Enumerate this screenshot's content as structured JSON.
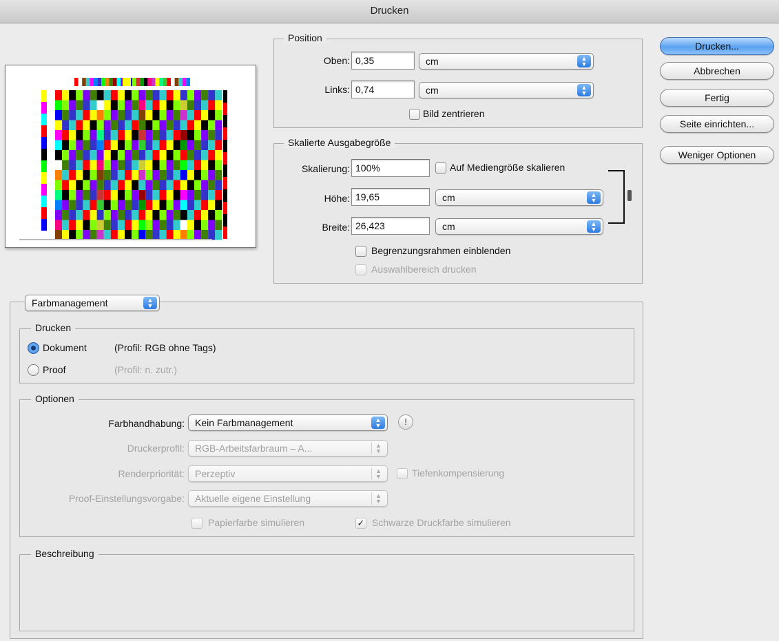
{
  "window": {
    "title": "Drucken"
  },
  "preview": {
    "caption": "Image of test colour chart"
  },
  "position": {
    "legend": "Position",
    "top_label": "Oben:",
    "top_value": "0,35",
    "top_unit": "cm",
    "left_label": "Links:",
    "left_value": "0,74",
    "left_unit": "cm",
    "center_label": "Bild zentrieren",
    "center_checked": false
  },
  "scaled": {
    "legend": "Skalierte Ausgabegröße",
    "scale_label": "Skalierung:",
    "scale_value": "100%",
    "fit_label": "Auf Mediengröße skalieren",
    "fit_checked": false,
    "height_label": "Höhe:",
    "height_value": "19,65",
    "height_unit": "cm",
    "width_label": "Breite:",
    "width_value": "26,423",
    "width_unit": "cm",
    "bbox_label": "Begrenzungsrahmen einblenden",
    "bbox_checked": false,
    "selection_label": "Auswahlbereich drucken",
    "selection_checked": false
  },
  "buttons": {
    "print": "Drucken...",
    "cancel": "Abbrechen",
    "done": "Fertig",
    "page_setup": "Seite einrichten...",
    "fewer_options": "Weniger Optionen"
  },
  "section_popup": {
    "value": "Farbmanagement"
  },
  "print_group": {
    "legend": "Drucken",
    "document_label": "Dokument",
    "document_profile": "(Profil: RGB ohne Tags)",
    "proof_label": "Proof",
    "proof_profile": "(Profil: n. zutr.)",
    "selected": "document"
  },
  "options": {
    "legend": "Optionen",
    "color_handling_label": "Farbhandhabung:",
    "color_handling_value": "Kein Farbmanagement",
    "printer_profile_label": "Druckerprofil:",
    "printer_profile_value": "RGB-Arbeitsfarbraum – A...",
    "rendering_label": "Renderpriorität:",
    "rendering_value": "Perzeptiv",
    "bpc_label": "Tiefenkompensierung",
    "bpc_checked": false,
    "proof_setup_label": "Proof-Einstellungsvorgabe:",
    "proof_setup_value": "Aktuelle eigene Einstellung",
    "paper_color_label": "Papierfarbe simulieren",
    "paper_color_checked": false,
    "black_ink_label": "Schwarze Druckfarbe simulieren",
    "black_ink_checked": true
  },
  "description": {
    "legend": "Beschreibung",
    "text": ""
  },
  "colors": {
    "accent": "#3b86e0",
    "window_bg": "#ececec"
  }
}
